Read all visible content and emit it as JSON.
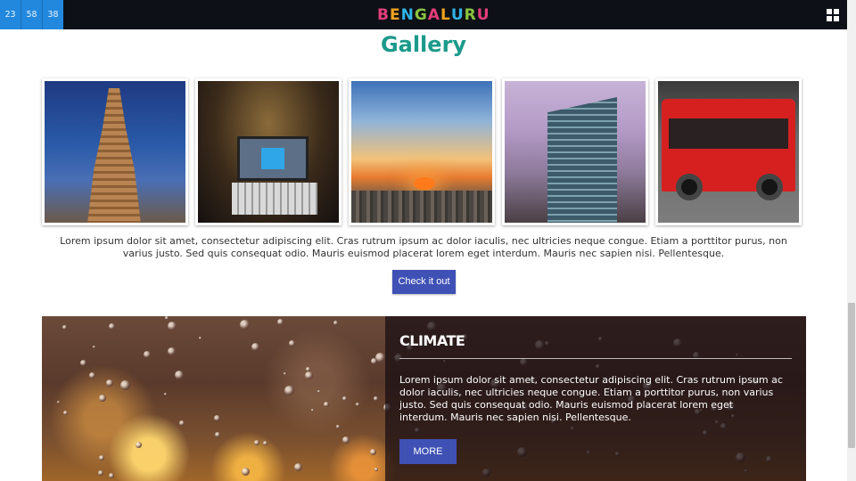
{
  "clock": {
    "hours": "23",
    "minutes": "58",
    "seconds": "38"
  },
  "header": {
    "logo_letters": [
      "B",
      "E",
      "N",
      "G",
      "A",
      "L",
      "U",
      "R",
      "U"
    ],
    "logo_colors": [
      "#e43d7a",
      "#f4a21d",
      "#2fb2e6",
      "#8ac43f",
      "#e43d7a",
      "#f4a21d",
      "#2fb2e6",
      "#8ac43f",
      "#e43d7a"
    ],
    "menu_icon": "grid-menu-icon"
  },
  "gallery": {
    "title": "Gallery",
    "photos": [
      {
        "subject": "temple-tower"
      },
      {
        "subject": "laptop-in-auto"
      },
      {
        "subject": "sunset-cityscape"
      },
      {
        "subject": "glass-skyscraper"
      },
      {
        "subject": "red-city-bus"
      }
    ],
    "description": "Lorem ipsum dolor sit amet, consectetur adipiscing elit. Cras rutrum ipsum ac dolor iaculis, nec ultricies neque congue. Etiam a porttitor purus, non varius justo. Sed quis consequat odio. Mauris euismod placerat lorem eget interdum. Mauris nec sapien nisi. Pellentesque.",
    "button_label": "Check it out"
  },
  "climate": {
    "title": "CLIMATE",
    "text": "Lorem ipsum dolor sit amet, consectetur adipiscing elit. Cras rutrum ipsum ac dolor iaculis, nec ultricies neque congue. Etiam a porttitor purus, non varius justo. Sed quis consequat odio. Mauris euismod placerat lorem eget interdum. Mauris nec sapien nisi. Pellentesque.",
    "button_label": "MORE"
  },
  "colors": {
    "accent": "#3f51b5",
    "title_teal": "#1b9a8a",
    "topbar": "#0d1117",
    "clock_blue": "#2288dd"
  }
}
